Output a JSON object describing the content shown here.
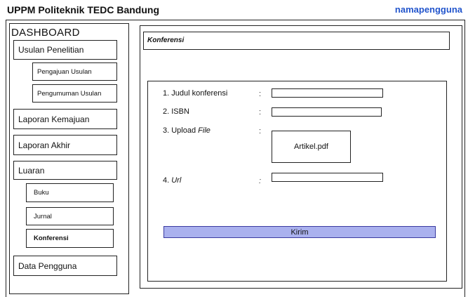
{
  "header": {
    "title": "UPPM Politeknik TEDC Bandung",
    "username": "namapengguna"
  },
  "sidebar": {
    "heading": "DASHBOARD",
    "usulan": "Usulan Penelitian",
    "pengajuan": "Pengajuan Usulan",
    "pengumuman": "Pengumuman Usulan",
    "laporan_kemajuan": "Laporan Kemajuan",
    "laporan_akhir": "Laporan Akhir",
    "luaran": "Luaran",
    "buku": "Buku",
    "jurnal": "Jurnal",
    "konferensi": "Konferensi",
    "data_pengguna": "Data Pengguna"
  },
  "main": {
    "title": "Konferensi",
    "form": {
      "judul_label": "1. Judul konferensi",
      "isbn_label": "2. ISBN",
      "upload_label_prefix": "3. Upload ",
      "upload_label_em": "File",
      "file_name": "Artikel.pdf",
      "url_label_prefix": "4. ",
      "url_label_em": "Url",
      "colon": ":",
      "judul_value": "",
      "isbn_value": "",
      "url_value": "",
      "submit_label": "Kirim"
    }
  },
  "colors": {
    "accent": "#2255cc",
    "submit_bg": "#aab1ee"
  }
}
